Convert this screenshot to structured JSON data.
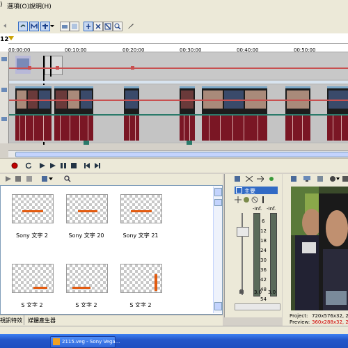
{
  "menu": {
    "items": [
      ")",
      "選項(O)",
      "說明(H)"
    ]
  },
  "ruler": {
    "ticks": [
      "00:00:00",
      "00:10:00",
      "00:20:00",
      "00:30:00",
      "00:40:00",
      "00:50:00"
    ],
    "marker": "12"
  },
  "media": {
    "items": [
      {
        "label": "Sony 文字 2"
      },
      {
        "label": "Sony 文字 20"
      },
      {
        "label": "Sony 文字 21"
      }
    ],
    "partial_labels": [
      "S   文字 2 ",
      "S   文字 2 ",
      "S   文字 2 "
    ]
  },
  "tabs": {
    "left": "視訊特效",
    "right": "媒體產生器"
  },
  "mixer": {
    "bus_label": "主要",
    "inf_left": "-Inf.",
    "inf_right": "-Inf.",
    "scale": [
      "6",
      "12",
      "18",
      "24",
      "30",
      "36",
      "42",
      "48",
      "54"
    ],
    "value_left": "3.0",
    "value_right": "3.0"
  },
  "preview": {
    "project_label": "Project:",
    "project_value": "720x576x32, 2",
    "preview_label": "Preview:",
    "preview_value": "360x288x32, 2"
  },
  "taskbar": {
    "task_label": "2115.veg - Sony Vega..."
  },
  "colors": {
    "accent": "#316ac5",
    "audio_waveform": "#7a1624",
    "taskbar": "#2457c9",
    "preview_value": "#d00000"
  }
}
